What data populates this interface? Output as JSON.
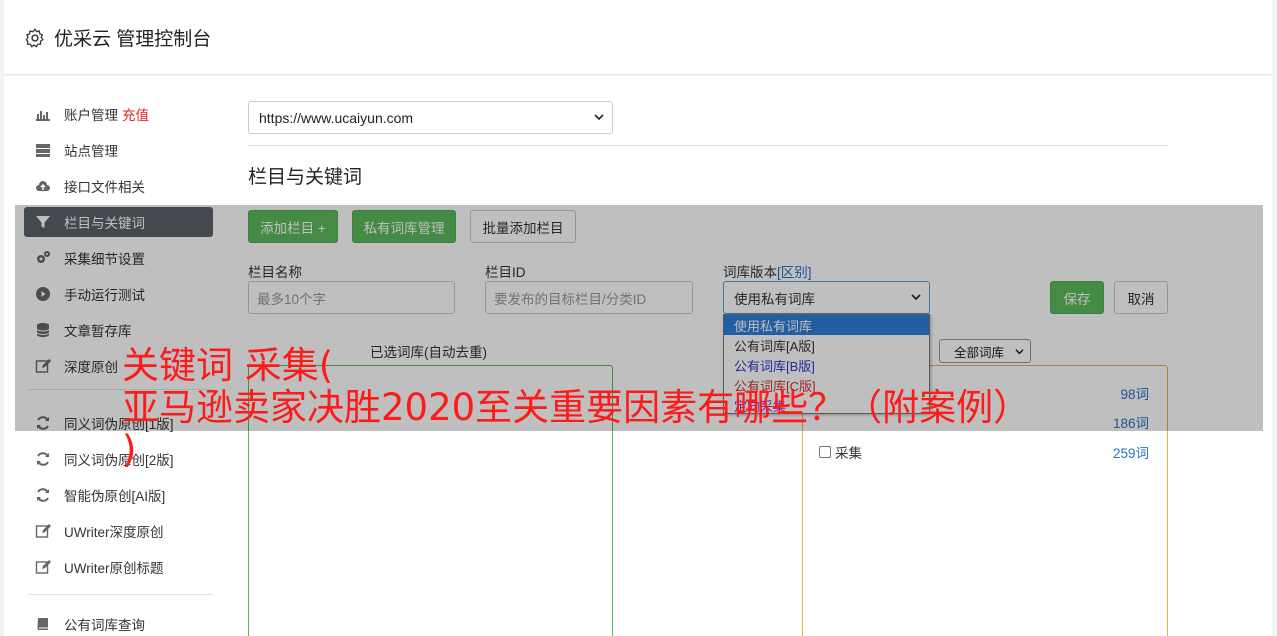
{
  "header": {
    "title": "优采云 管理控制台"
  },
  "sidebar": {
    "items": [
      {
        "label": "账户管理",
        "badge": "充值",
        "icon": "bar-chart-icon"
      },
      {
        "label": "站点管理",
        "icon": "server-icon"
      },
      {
        "label": "接口文件相关",
        "icon": "cloud-upload-icon"
      },
      {
        "label": "栏目与关键词",
        "icon": "filter-icon",
        "active": true
      },
      {
        "label": "采集细节设置",
        "icon": "cogs-icon"
      },
      {
        "label": "手动运行测试",
        "icon": "play-circle-icon"
      },
      {
        "label": "文章暂存库",
        "icon": "database-icon"
      },
      {
        "label": "深度原创",
        "icon": "edit-icon"
      },
      {
        "label": "同义词伪原创[1版]",
        "icon": "refresh-icon"
      },
      {
        "label": "同义词伪原创[2版]",
        "icon": "refresh-icon"
      },
      {
        "label": "智能伪原创[AI版]",
        "icon": "refresh-icon"
      },
      {
        "label": "UWriter深度原创",
        "icon": "edit-icon"
      },
      {
        "label": "UWriter原创标题",
        "icon": "edit-icon"
      },
      {
        "label": "公有词库查询",
        "icon": "book-icon"
      }
    ]
  },
  "content": {
    "site_select": "https://www.ucaiyun.com",
    "section_title": "栏目与关键词",
    "buttons": {
      "add_column": "添加栏目 +",
      "private_lib": "私有词库管理",
      "batch_add": "批量添加栏目",
      "save": "保存",
      "cancel": "取消"
    },
    "fields": {
      "column_name_label": "栏目名称",
      "column_name_placeholder": "最多10个字",
      "column_id_label": "栏目ID",
      "column_id_placeholder": "要发布的目标栏目/分类ID",
      "lib_version_label": "词库版本",
      "lib_version_link": "[区别]",
      "lib_version_value": "使用私有词库"
    },
    "dropdown_options": [
      {
        "label": "使用私有词库",
        "color": "#ffffff"
      },
      {
        "label": "公有词库[A版]",
        "color": "#333333"
      },
      {
        "label": "公有词库[B版]",
        "color": "#3333cc"
      },
      {
        "label": "公有词库[C版]",
        "color": "#cc3333"
      },
      {
        "label": "定向采集",
        "color": "#9933cc"
      }
    ],
    "selected_lib_label": "已选词库(自动去重)",
    "all_libs_select": "全部词库",
    "lib_rows": [
      {
        "name": "",
        "count": "98词"
      },
      {
        "name": "",
        "count": "186词"
      },
      {
        "name": "采集",
        "count": "259词"
      }
    ]
  },
  "watermark": {
    "line1": "关键词 采集(",
    "line2": "亚马逊卖家决胜2020至关重要因素有哪些？（附案例）",
    "line3": ")"
  }
}
